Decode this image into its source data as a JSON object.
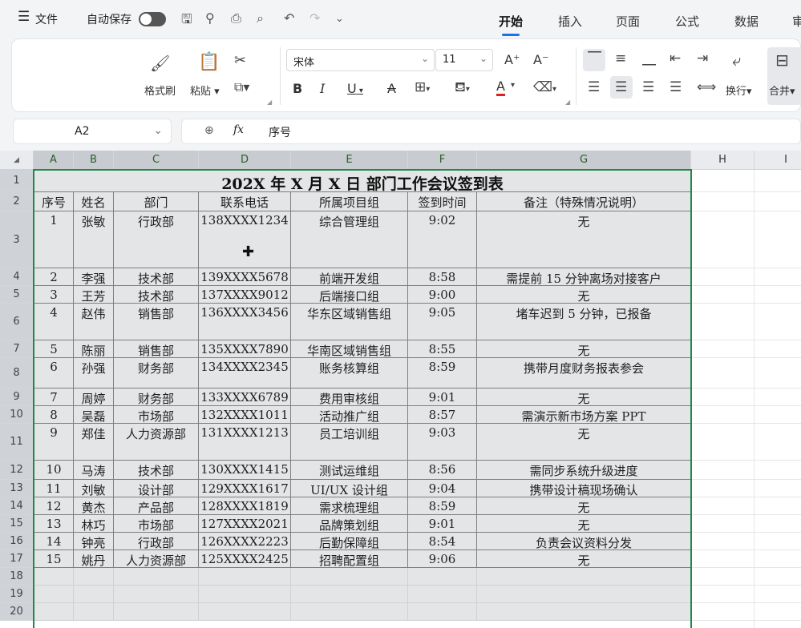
{
  "topbar": {
    "menu_icon": "hamburger-icon",
    "file_label": "文件",
    "autosave_label": "自动保存",
    "tabs": [
      {
        "label": "开始",
        "active": true
      },
      {
        "label": "插入"
      },
      {
        "label": "页面"
      },
      {
        "label": "公式"
      },
      {
        "label": "数据"
      },
      {
        "label": "审"
      }
    ]
  },
  "ribbon": {
    "format_painter": "格式刷",
    "paste": "粘贴",
    "font_name": "宋体",
    "font_size": "11",
    "wrap_label": "换行",
    "merge_label": "合并",
    "bold": "B",
    "italic": "I",
    "underline": "U",
    "strike": "A",
    "font_color_letter": "A",
    "font_grow": "A⁺",
    "font_shrink": "A⁻"
  },
  "formula_bar": {
    "cell_ref": "A2",
    "fx": "fx",
    "content": "序号"
  },
  "columns": [
    "A",
    "B",
    "C",
    "D",
    "E",
    "F",
    "G",
    "H",
    "I"
  ],
  "rows": [
    "1",
    "2",
    "3",
    "4",
    "5",
    "6",
    "7",
    "8",
    "9",
    "10",
    "11",
    "12",
    "13",
    "14",
    "15",
    "16",
    "17",
    "18",
    "19",
    "20"
  ],
  "sheet": {
    "title": "202X 年 X 月 X 日 部门工作会议签到表",
    "headers": [
      "序号",
      "姓名",
      "部门",
      "联系电话",
      "所属项目组",
      "签到时间",
      "备注（特殊情况说明）"
    ],
    "records": [
      [
        "1",
        "张敏",
        "行政部",
        "138XXXX1234",
        "综合管理组",
        "9:02",
        "无"
      ],
      [
        "2",
        "李强",
        "技术部",
        "139XXXX5678",
        "前端开发组",
        "8:58",
        "需提前 15 分钟离场对接客户"
      ],
      [
        "3",
        "王芳",
        "技术部",
        "137XXXX9012",
        "后端接口组",
        "9:00",
        "无"
      ],
      [
        "4",
        "赵伟",
        "销售部",
        "136XXXX3456",
        "华东区域销售组",
        "9:05",
        "堵车迟到 5 分钟，已报备"
      ],
      [
        "5",
        "陈丽",
        "销售部",
        "135XXXX7890",
        "华南区域销售组",
        "8:55",
        "无"
      ],
      [
        "6",
        "孙强",
        "财务部",
        "134XXXX2345",
        "账务核算组",
        "8:59",
        "携带月度财务报表参会"
      ],
      [
        "7",
        "周婷",
        "财务部",
        "133XXXX6789",
        "费用审核组",
        "9:01",
        "无"
      ],
      [
        "8",
        "吴磊",
        "市场部",
        "132XXXX1011",
        "活动推广组",
        "8:57",
        "需演示新市场方案 PPT"
      ],
      [
        "9",
        "郑佳",
        "人力资源部",
        "131XXXX1213",
        "员工培训组",
        "9:03",
        "无"
      ],
      [
        "10",
        "马涛",
        "技术部",
        "130XXXX1415",
        "测试运维组",
        "8:56",
        "需同步系统升级进度"
      ],
      [
        "11",
        "刘敏",
        "设计部",
        "129XXXX1617",
        "UI/UX 设计组",
        "9:04",
        "携带设计稿现场确认"
      ],
      [
        "12",
        "黄杰",
        "产品部",
        "128XXXX1819",
        "需求梳理组",
        "8:59",
        "无"
      ],
      [
        "13",
        "林巧",
        "市场部",
        "127XXXX2021",
        "品牌策划组",
        "9:01",
        "无"
      ],
      [
        "14",
        "钟亮",
        "行政部",
        "126XXXX2223",
        "后勤保障组",
        "8:54",
        "负责会议资料分发"
      ],
      [
        "15",
        "姚丹",
        "人力资源部",
        "125XXXX2425",
        "招聘配置组",
        "9:06",
        "无"
      ]
    ]
  },
  "accent_color": "#1e8a4a"
}
